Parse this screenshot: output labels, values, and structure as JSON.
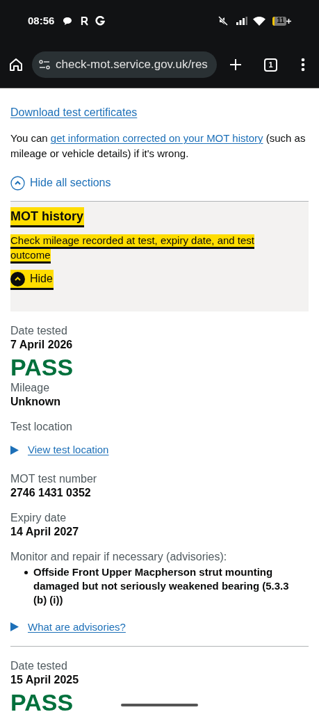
{
  "status_bar": {
    "time": "08:56",
    "battery": "11"
  },
  "browser": {
    "url": "check-mot.service.gov.uk/res",
    "tab_count": "1"
  },
  "intro": {
    "download_link": "Download test certificates",
    "correction_before": "You can ",
    "correction_link": "get information corrected on your MOT history",
    "correction_after": " (such as mileage or vehicle details) if it's wrong."
  },
  "hide_all": "Hide all sections",
  "section": {
    "title": "MOT history",
    "summary": "Check mileage recorded at test, expiry date, and test outcome",
    "toggle": "Hide",
    "expanded": true
  },
  "tests": [
    {
      "date_label": "Date tested",
      "date": "7 April 2026",
      "result": "PASS",
      "mileage_label": "Mileage",
      "mileage": "Unknown",
      "location_label": "Test location",
      "location_link": "View test location",
      "number_label": "MOT test number",
      "number": "2746 1431 0352",
      "expiry_label": "Expiry date",
      "expiry": "14 April 2027",
      "advisories_label": "Monitor and repair if necessary (advisories):",
      "advisories": [
        "Offside Front Upper Macpherson strut mounting damaged but not seriously weakened bearing (5.3.3 (b) (i))"
      ],
      "advisories_link": "What are advisories?"
    },
    {
      "date_label": "Date tested",
      "date": "15 April 2025",
      "result": "PASS"
    }
  ]
}
